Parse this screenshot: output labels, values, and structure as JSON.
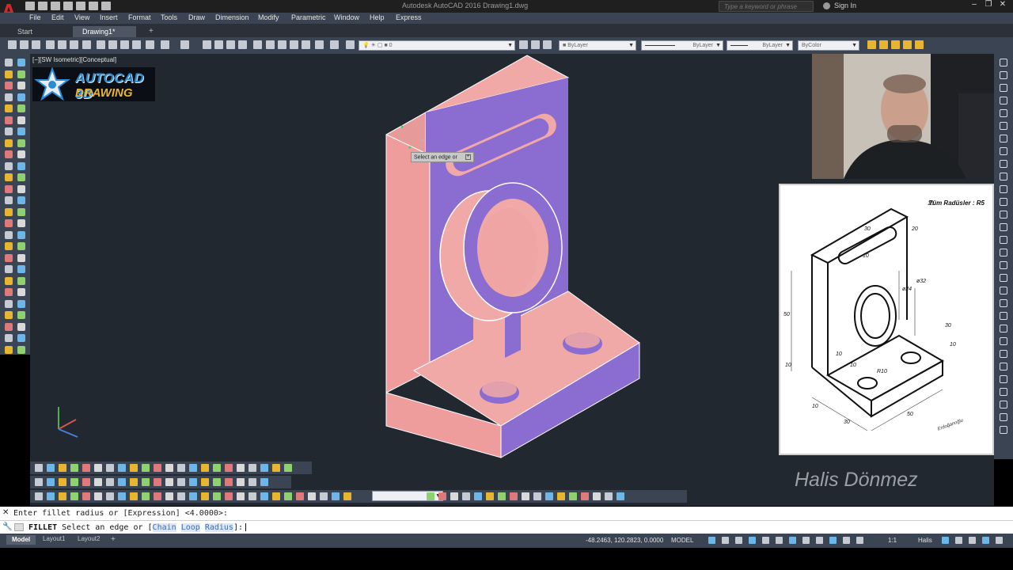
{
  "window": {
    "title": "Autodesk AutoCAD 2016   Drawing1.dwg",
    "search_placeholder": "Type a keyword or phrase",
    "sign_in": "Sign In",
    "controls": [
      "–",
      "❐",
      "✕"
    ]
  },
  "menu": [
    "File",
    "Edit",
    "View",
    "Insert",
    "Format",
    "Tools",
    "Draw",
    "Dimension",
    "Modify",
    "Parametric",
    "Window",
    "Help",
    "Express"
  ],
  "file_tabs": {
    "start": "Start",
    "drawing": "Drawing1*",
    "new": "+"
  },
  "properties": {
    "layer": "0",
    "color": "ByLayer",
    "linetype": "ByLayer",
    "lineweight": "ByLayer",
    "plotstyle": "ByColor"
  },
  "viewport": {
    "label": "[−][SW Isometric][Conceptual]",
    "tooltip": "Select an edge or",
    "tooltip_more": "+"
  },
  "logo": {
    "line1": "AUTOCAD 3D",
    "line2": "DRAWING"
  },
  "reference": {
    "title": "Tüm Radüsler : R5",
    "dims": {
      "d15": "15",
      "d30a": "30",
      "d20": "20",
      "d10a": "10",
      "d032": "ø32",
      "d024": "ø24",
      "d50a": "50",
      "d30b": "30",
      "d10b": "10",
      "d10c": "10",
      "d10d": "10",
      "d10e": "10",
      "dr10": "R10",
      "d10f": "10",
      "d30c": "30",
      "d50b": "50"
    },
    "signature": "Erdoğanoğlu"
  },
  "watermark": "Halis Dönmez",
  "command": {
    "history": "Enter fillet radius or [Expression] <4.0000>:",
    "prefix": "FILLET",
    "prompt": "Select an edge or [",
    "kw1": "Chain",
    "kw2": "Loop",
    "kw3": "Radius",
    "suffix": "]:"
  },
  "layout_tabs": {
    "model": "Model",
    "layout1": "Layout1",
    "layout2": "Layout2",
    "add": "+"
  },
  "status": {
    "coords": "-48.2463, 120.2823, 0.0000",
    "space": "MODEL",
    "scale": "1:1",
    "user": "Halis"
  },
  "colors": {
    "part_light": "#f0a9a6",
    "part_face": "#e79a9a",
    "part_dark": "#8b6cd0",
    "viewport_bg": "#212830",
    "ui_panel": "#3b4453"
  }
}
